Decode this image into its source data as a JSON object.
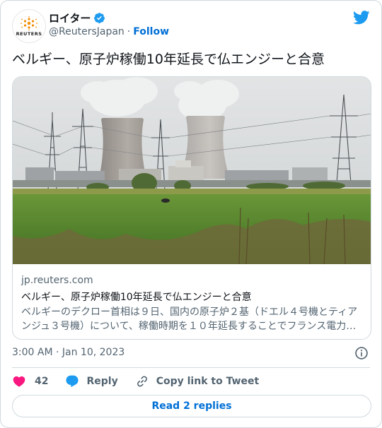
{
  "account": {
    "display_name": "ロイター",
    "handle": "@ReutersJapan",
    "separator": "·",
    "follow_label": "Follow",
    "avatar_text": "REUTERS"
  },
  "tweet": {
    "text": "ベルギー、原子炉稼働10年延長で仏エンジーと合意"
  },
  "card": {
    "domain": "jp.reuters.com",
    "title": "ベルギー、原子炉稼働10年延長で仏エンジーと合意",
    "description": "ベルギーのデクロー首相は９日、国内の原子炉２基（ドエル４号機とティアンジュ３号機）について、稼働時期を１０年延長することでフランス電力大手エンジーと合意した。",
    "image_subject": "cooling towers of a nuclear power plant behind a green field"
  },
  "timestamp": "3:00 AM · Jan 10, 2023",
  "actions": {
    "like_count": "42",
    "reply_label": "Reply",
    "copy_label": "Copy link to Tweet"
  },
  "read_replies_label": "Read 2 replies",
  "colors": {
    "accent": "#1d9bf0",
    "link": "#006fd6",
    "like": "#f91880",
    "muted": "#536471",
    "border": "#cfd9de"
  },
  "icons": {
    "verified": "verified-badge-icon",
    "brand": "twitter-bird-icon",
    "info": "info-icon",
    "like": "heart-icon",
    "reply": "speech-bubble-icon",
    "copy": "link-icon"
  }
}
